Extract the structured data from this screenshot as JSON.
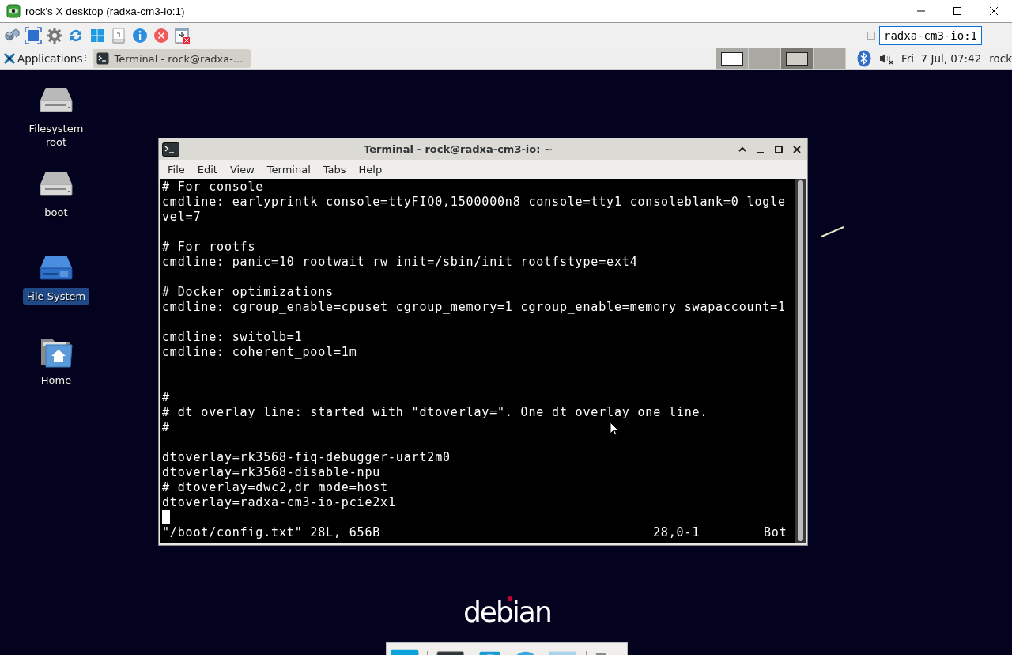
{
  "window": {
    "title": "rock's X desktop (radxa-cm3-io:1)"
  },
  "toolbar": {
    "host_field": {
      "value": "radxa-cm3-io:1"
    }
  },
  "panel": {
    "applications_label": "Applications",
    "tasks": [
      {
        "label": "Terminal - rock@radxa-...",
        "selected": true
      }
    ],
    "workspaces": [
      {
        "selected": false,
        "has_window": true
      },
      {
        "selected": false,
        "has_window": false
      },
      {
        "selected": true,
        "has_window": true
      },
      {
        "selected": false,
        "has_window": false
      }
    ],
    "clock": "Fri  7 Jul, 07:42",
    "user": "rock"
  },
  "desktop": {
    "icons": [
      {
        "label": "Filesystem root",
        "kind": "drive",
        "selected": false
      },
      {
        "label": "boot",
        "kind": "drive",
        "selected": false
      },
      {
        "label": "File System",
        "kind": "filesystem",
        "selected": true
      },
      {
        "label": "Home",
        "kind": "home",
        "selected": false
      }
    ],
    "logo": "debian"
  },
  "terminal": {
    "title": "Terminal - rock@radxa-cm3-io: ~",
    "menu": [
      "File",
      "Edit",
      "View",
      "Terminal",
      "Tabs",
      "Help"
    ],
    "lines": [
      {
        "kind": "text",
        "text": "# For console"
      },
      {
        "kind": "text",
        "text": "cmdline: earlyprintk console=ttyFIQ0,1500000n8 console=tty1 consoleblank=0 logle"
      },
      {
        "kind": "text",
        "text": "vel=7"
      },
      {
        "kind": "blank"
      },
      {
        "kind": "text",
        "text": "# For rootfs"
      },
      {
        "kind": "text",
        "text": "cmdline: panic=10 rootwait rw init=/sbin/init rootfstype=ext4"
      },
      {
        "kind": "blank"
      },
      {
        "kind": "text",
        "text": "# Docker optimizations"
      },
      {
        "kind": "text",
        "text": "cmdline: cgroup_enable=cpuset cgroup_memory=1 cgroup_enable=memory swapaccount=1"
      },
      {
        "kind": "blank"
      },
      {
        "kind": "text",
        "text": "cmdline: switolb=1"
      },
      {
        "kind": "text",
        "text": "cmdline: coherent_pool=1m"
      },
      {
        "kind": "blank"
      },
      {
        "kind": "blank"
      },
      {
        "kind": "text",
        "text": "#"
      },
      {
        "kind": "text",
        "text": "# dt overlay line: started with \"dtoverlay=\". One dt overlay one line."
      },
      {
        "kind": "text",
        "text": "#"
      },
      {
        "kind": "blank"
      },
      {
        "kind": "text",
        "text": "dtoverlay=rk3568-fiq-debugger-uart2m0"
      },
      {
        "kind": "text",
        "text": "dtoverlay=rk3568-disable-npu"
      },
      {
        "kind": "text",
        "text": "# dtoverlay=dwc2,dr_mode=host"
      },
      {
        "kind": "text",
        "text": "dtoverlay=radxa-cm3-io-pcie2x1"
      },
      {
        "kind": "cursor"
      }
    ],
    "status": {
      "file": "\"/boot/config.txt\" 28L, 656B",
      "position": "28,0-1",
      "scroll": "Bot"
    }
  }
}
